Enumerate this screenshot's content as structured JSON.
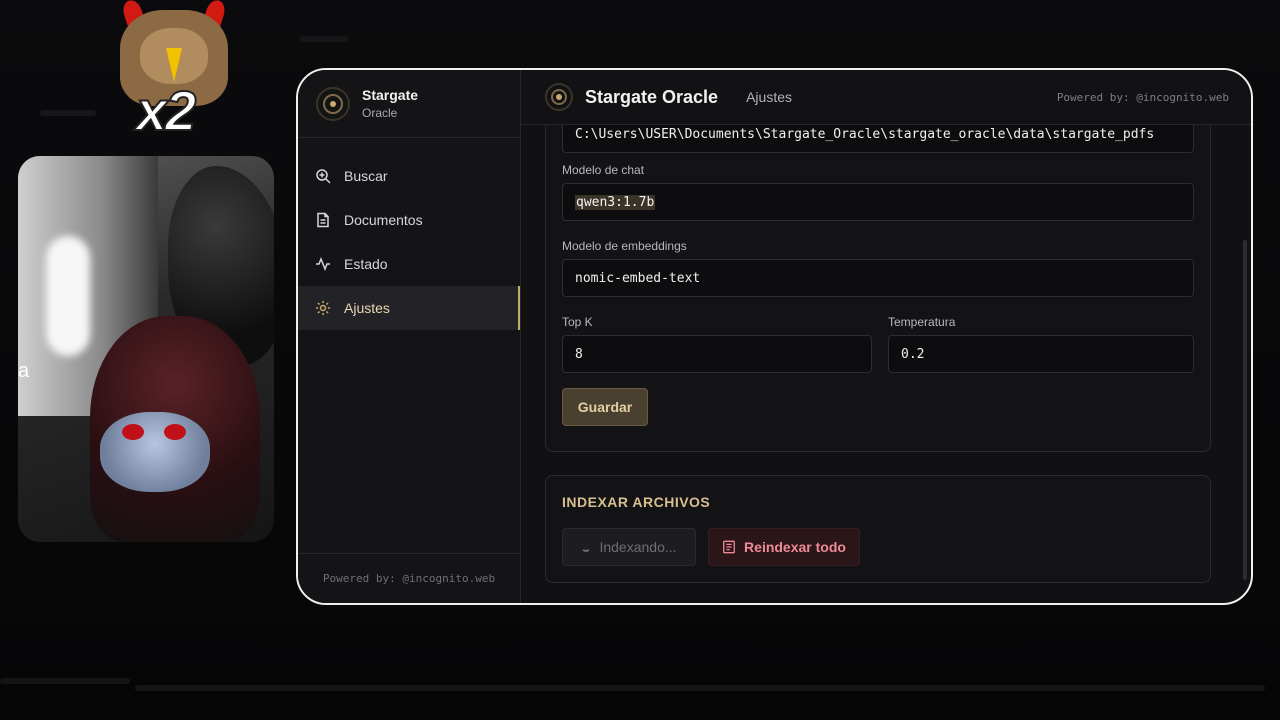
{
  "overlay": {
    "badge_text": "x2",
    "cam_text": "a"
  },
  "sidebar": {
    "brand_title": "Stargate",
    "brand_sub": "Oracle",
    "items": [
      {
        "label": "Buscar",
        "icon": "search-plus-icon"
      },
      {
        "label": "Documentos",
        "icon": "document-icon"
      },
      {
        "label": "Estado",
        "icon": "activity-icon"
      },
      {
        "label": "Ajustes",
        "icon": "gear-icon",
        "active": true
      }
    ],
    "footer": "Powered by: @incognito.web"
  },
  "header": {
    "title": "Stargate Oracle",
    "crumb": "Ajustes",
    "powered": "Powered by: @incognito.web"
  },
  "settings": {
    "path_value": "C:\\Users\\USER\\Documents\\Stargate_Oracle\\stargate_oracle\\data\\stargate_pdfs",
    "chat_model_label": "Modelo de chat",
    "chat_model_value": "qwen3:1.7b",
    "embed_model_label": "Modelo de embeddings",
    "embed_model_value": "nomic-embed-text",
    "topk_label": "Top K",
    "topk_value": "8",
    "temp_label": "Temperatura",
    "temp_value": "0.2",
    "save_label": "Guardar"
  },
  "index": {
    "title": "INDEXAR ARCHIVOS",
    "indexing_label": "Indexando...",
    "reindex_label": "Reindexar todo"
  },
  "colors": {
    "accent": "#c9a86a",
    "danger": "#f08a98",
    "bg": "#111114"
  }
}
